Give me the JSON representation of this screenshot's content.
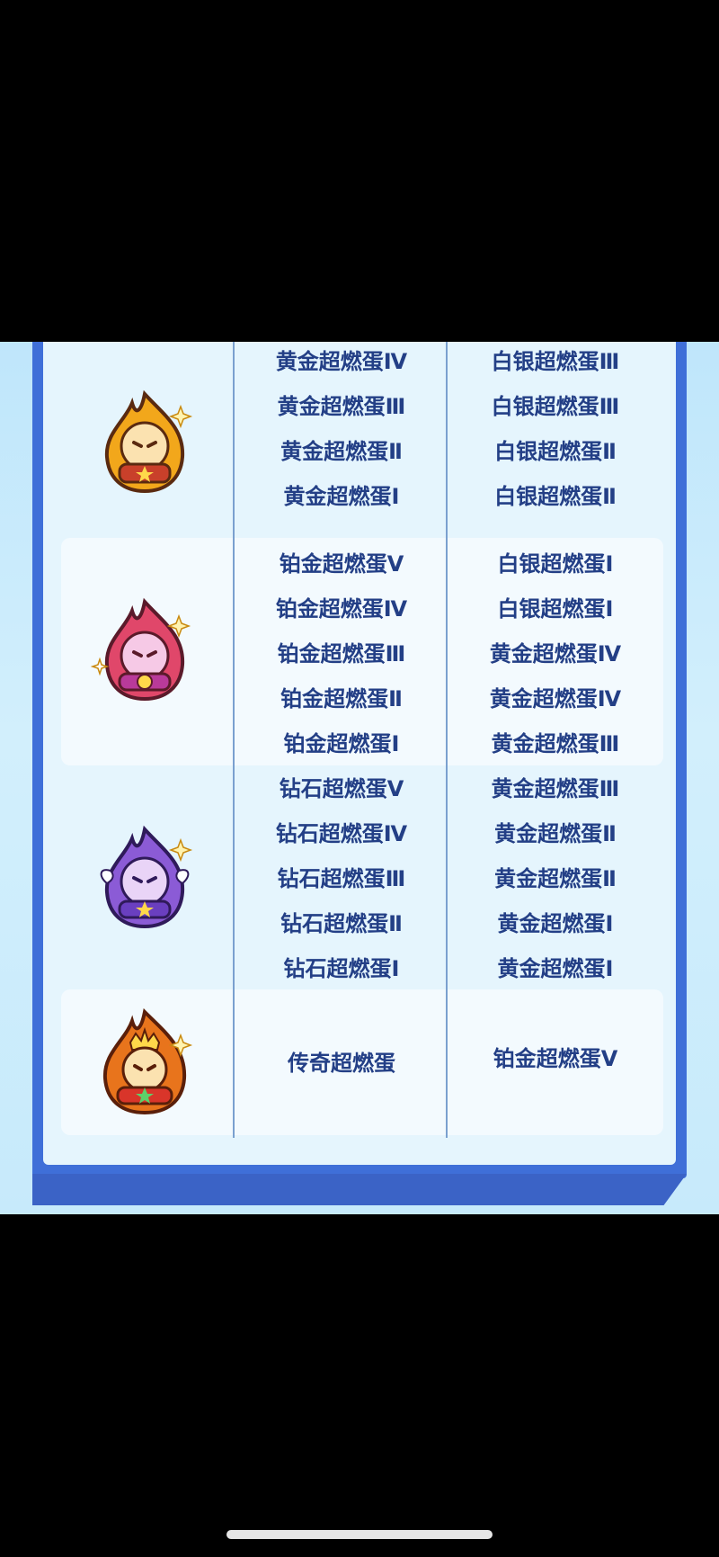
{
  "table": {
    "tiers": [
      {
        "icon": "gold-flame-egg-icon",
        "col_a": [
          "黄金超燃蛋Ⅳ",
          "黄金超燃蛋Ⅲ",
          "黄金超燃蛋Ⅱ",
          "黄金超燃蛋Ⅰ"
        ],
        "col_b": [
          "白银超燃蛋Ⅲ",
          "白银超燃蛋Ⅲ",
          "白银超燃蛋Ⅱ",
          "白银超燃蛋Ⅱ"
        ]
      },
      {
        "icon": "platinum-flame-egg-icon",
        "col_a": [
          "铂金超燃蛋Ⅴ",
          "铂金超燃蛋Ⅳ",
          "铂金超燃蛋Ⅲ",
          "铂金超燃蛋Ⅱ",
          "铂金超燃蛋Ⅰ"
        ],
        "col_b": [
          "白银超燃蛋Ⅰ",
          "白银超燃蛋Ⅰ",
          "黄金超燃蛋Ⅳ",
          "黄金超燃蛋Ⅳ",
          "黄金超燃蛋Ⅲ"
        ]
      },
      {
        "icon": "diamond-flame-egg-icon",
        "col_a": [
          "钻石超燃蛋Ⅴ",
          "钻石超燃蛋Ⅳ",
          "钻石超燃蛋Ⅲ",
          "钻石超燃蛋Ⅱ",
          "钻石超燃蛋Ⅰ"
        ],
        "col_b": [
          "黄金超燃蛋Ⅲ",
          "黄金超燃蛋Ⅱ",
          "黄金超燃蛋Ⅱ",
          "黄金超燃蛋Ⅰ",
          "黄金超燃蛋Ⅰ"
        ]
      },
      {
        "icon": "legend-flame-egg-icon",
        "col_a": [
          "传奇超燃蛋"
        ],
        "col_b": [
          "铂金超燃蛋Ⅴ"
        ]
      }
    ]
  },
  "colors": {
    "frame": "#3f6fd8",
    "text": "#233f86",
    "gold": "#f2a71b",
    "platinum": "#e0476a",
    "diamond": "#8b5bd6",
    "legend": "#e8741c"
  }
}
